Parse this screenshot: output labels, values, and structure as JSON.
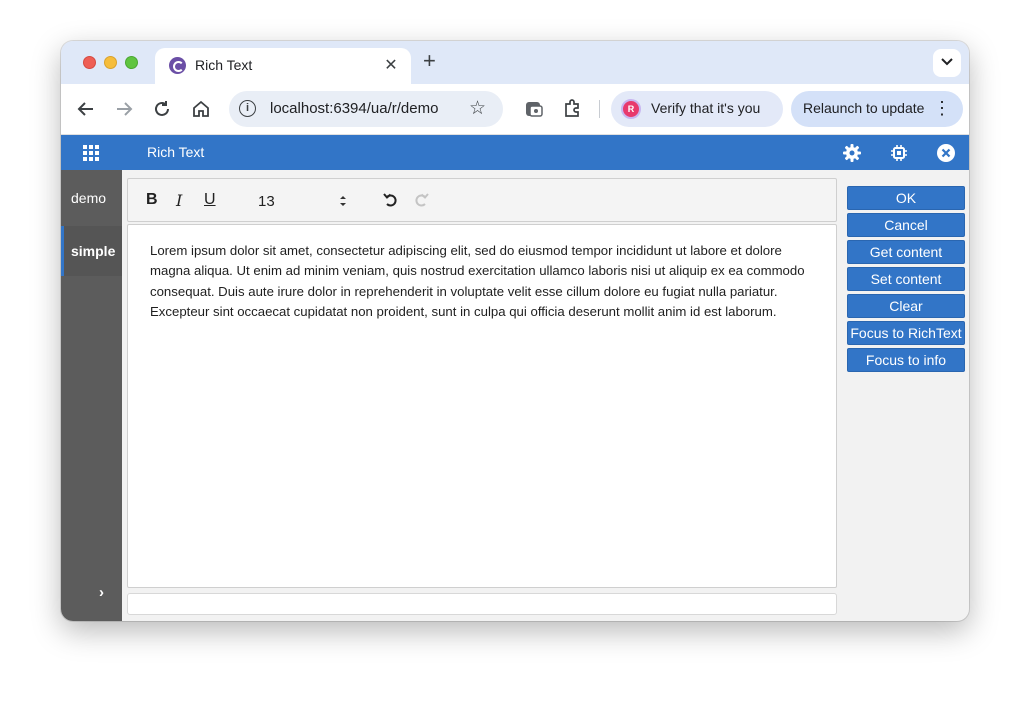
{
  "browser": {
    "tab_title": "Rich Text",
    "url": "localhost:6394/ua/r/demo",
    "verify_label": "Verify that it's you",
    "verify_avatar_letter": "R",
    "relaunch_label": "Relaunch to update"
  },
  "app": {
    "title": "Rich Text"
  },
  "sidebar": {
    "items": [
      {
        "label": "demo"
      },
      {
        "label": "simple"
      }
    ]
  },
  "editor": {
    "toolbar": {
      "bold": "B",
      "italic": "I",
      "underline": "U",
      "font_size": "13"
    },
    "content": "Lorem ipsum dolor sit amet, consectetur adipiscing elit, sed do eiusmod tempor incididunt ut labore et dolore magna aliqua. Ut enim ad minim veniam, quis nostrud exercitation ullamco laboris nisi ut aliquip ex ea commodo consequat. Duis aute irure dolor in reprehenderit in voluptate velit esse cillum dolore eu fugiat nulla pariatur. Excepteur sint occaecat cupidatat non proident, sunt in culpa qui officia deserunt mollit anim id est laborum."
  },
  "actions": {
    "ok": "OK",
    "cancel": "Cancel",
    "get_content": "Get content",
    "set_content": "Set content",
    "clear": "Clear",
    "focus_richtext": "Focus to RichText",
    "focus_info": "Focus to info"
  },
  "colors": {
    "header_blue": "#3275c7",
    "sidebar_gray": "#5c5c5c"
  }
}
